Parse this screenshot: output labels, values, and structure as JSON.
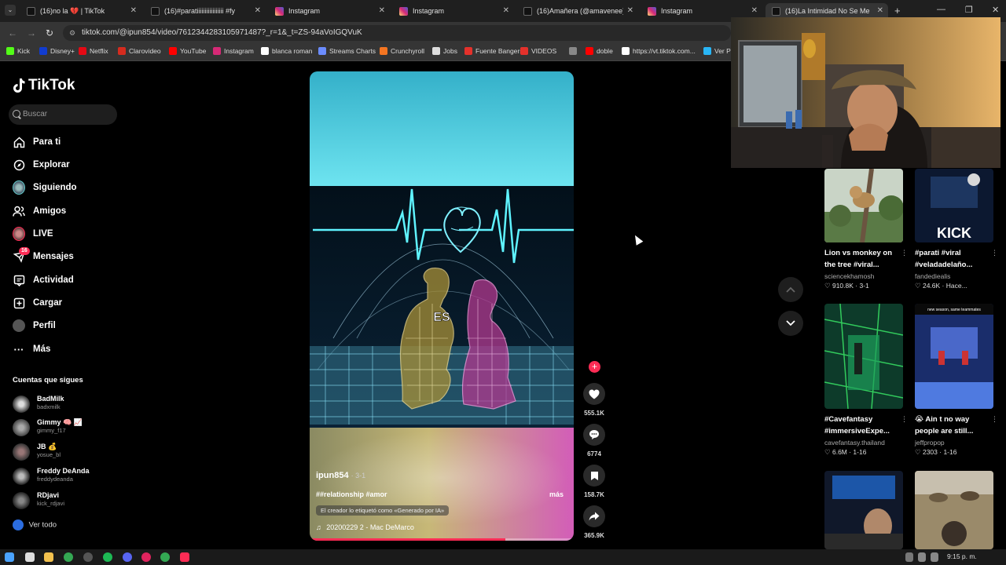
{
  "browser": {
    "tabs": [
      {
        "title": "(16)no la 💔 | TikTok",
        "icon": "tiktok-icon"
      },
      {
        "title": "(16)#paratiіііііііііііііііі #fy",
        "icon": "tiktok-icon"
      },
      {
        "title": "Instagram",
        "icon": "instagram-icon"
      },
      {
        "title": "Instagram",
        "icon": "instagram-icon"
      },
      {
        "title": "(16)Amañera (@amavenee) | Ti",
        "icon": "tiktok-icon"
      },
      {
        "title": "Instagram",
        "icon": "instagram-icon"
      },
      {
        "title": "(16)La Intimidad No Se Me",
        "icon": "tiktok-icon"
      }
    ],
    "url": "tiktok.com/@ipun854/video/7612344283105971487?_r=1&_t=ZS-94aVoIGQVuK",
    "bookmarks": [
      {
        "label": "Kick",
        "color": "#53fc18"
      },
      {
        "label": "Disney+",
        "color": "#113ccf"
      },
      {
        "label": "Netflix",
        "color": "#e50914"
      },
      {
        "label": "Clarovideo",
        "color": "#d52b1e"
      },
      {
        "label": "YouTube",
        "color": "#ff0000"
      },
      {
        "label": "Instagram",
        "color": "#d62976"
      },
      {
        "label": "blanca roman",
        "color": "#ffffff"
      },
      {
        "label": "Streams Charts",
        "color": "#6b8cff"
      },
      {
        "label": "Crunchyroll",
        "color": "#f47521"
      },
      {
        "label": "Jobs",
        "color": "#dddddd"
      },
      {
        "label": "Fuente Bangers",
        "color": "#e4312b"
      },
      {
        "label": "VIDEOS",
        "color": "#e4312b"
      },
      {
        "label": "",
        "color": "#888888"
      },
      {
        "label": "doble",
        "color": "#ff0000"
      },
      {
        "label": "https://vt.tiktok.com...",
        "color": "#ffffff"
      },
      {
        "label": "Ver Pa",
        "color": "#29b6f6"
      }
    ]
  },
  "sidebar": {
    "logo": "TikTok",
    "search_placeholder": "Buscar",
    "nav": [
      {
        "label": "Para ti",
        "icon": "home-icon"
      },
      {
        "label": "Explorar",
        "icon": "compass-icon"
      },
      {
        "label": "Siguiendo",
        "icon": "following-avatar-icon"
      },
      {
        "label": "Amigos",
        "icon": "friends-icon"
      },
      {
        "label": "LIVE",
        "icon": "live-icon"
      },
      {
        "label": "Mensajes",
        "icon": "inbox-icon",
        "badge": "16"
      },
      {
        "label": "Actividad",
        "icon": "activity-icon"
      },
      {
        "label": "Cargar",
        "icon": "upload-icon"
      },
      {
        "label": "Perfil",
        "icon": "profile-icon"
      },
      {
        "label": "Más",
        "icon": "more-icon"
      }
    ],
    "following_title": "Cuentas que sigues",
    "following": [
      {
        "name": "BadMilk",
        "handle": "badxmilk"
      },
      {
        "name": "Gimmy 🧠 📈",
        "handle": "gimmy_f17"
      },
      {
        "name": "JB 💰",
        "handle": "yosue_bl"
      },
      {
        "name": "Freddy DeAnda",
        "handle": "freddydeanda"
      },
      {
        "name": "RDjavi",
        "handle": "kick_rdjavi"
      }
    ],
    "see_all": "Ver todo"
  },
  "video": {
    "overlay_word": "ES",
    "author": "ipun854",
    "date": "3-1",
    "hashtags": "##relationship #amor",
    "more": "más",
    "ai_label": "El creador lo etiquetó como «Generado por IA»",
    "music": "20200229 2 - Mac DeMarco",
    "progress": 0.74
  },
  "actions": {
    "likes": "555.1K",
    "comments": "6774",
    "saves": "158.7K",
    "shares": "365.9K"
  },
  "suggestions": [
    {
      "title": "Lion vs monkey on the tree #viral...",
      "author": "sciencekhamosh",
      "stats": "♡ 910.8K · 3-1"
    },
    {
      "title": "#parati #viral #veladadelaño...",
      "author": "fandediealis",
      "stats": "♡ 24.6K · Hace...",
      "thumb_text": "KICK"
    },
    {
      "title": "#Cavefantasy #immersiveExpe...",
      "author": "cavefantasy.thailand",
      "stats": "♡ 6.6M · 1-16"
    },
    {
      "title": "😭 Ain t no way people are still...",
      "author": "jeffpropop",
      "stats": "♡ 2303 · 1-16",
      "thumb_text": "new season, same teammates"
    }
  ],
  "taskbar": {
    "time": "9:15 p. m."
  }
}
